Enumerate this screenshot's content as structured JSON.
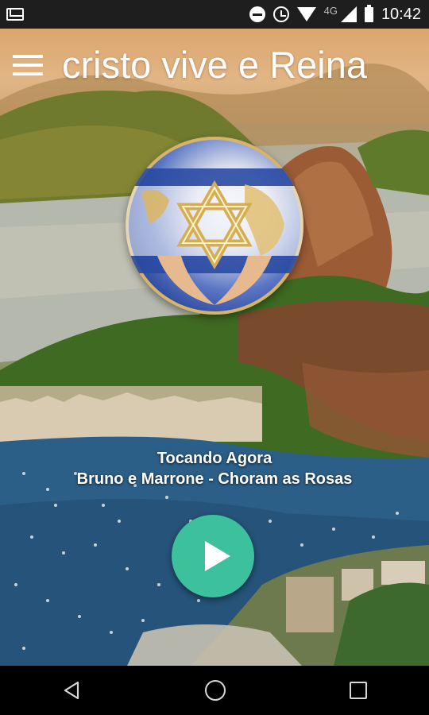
{
  "status_bar": {
    "network_label": "4G",
    "time": "10:42",
    "icons": [
      "gmail-icon",
      "do-not-disturb-icon",
      "alarm-icon",
      "wifi-icon",
      "signal-icon",
      "battery-icon"
    ]
  },
  "app_bar": {
    "title": "cristo vive e Reina",
    "menu_icon": "hamburger-menu-icon"
  },
  "logo": {
    "icon": "star-of-david-globe-logo"
  },
  "player": {
    "now_playing_label": "Tocando Agora",
    "track": "Bruno e Marrone - Choram as Rosas",
    "play_icon": "play-icon",
    "accent_color": "#3cc19c"
  },
  "nav_bar": {
    "icons": [
      "back-icon",
      "home-icon",
      "recents-icon"
    ]
  }
}
